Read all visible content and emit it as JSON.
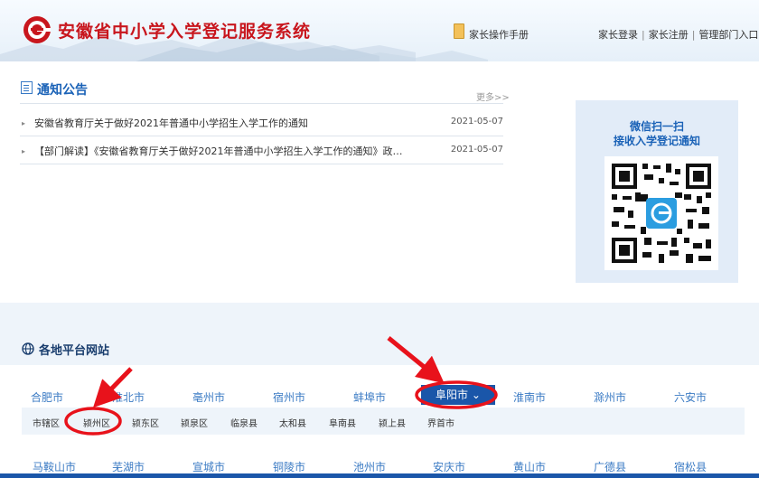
{
  "header": {
    "title": "安徽省中小学入学登记服务系统",
    "manual": "家长操作手册",
    "nav": [
      "家长登录",
      "家长注册",
      "管理部门入口"
    ]
  },
  "notice": {
    "title": "通知公告",
    "more": "更多>>",
    "items": [
      {
        "title": "安徽省教育厅关于做好2021年普通中小学招生入学工作的通知",
        "date": "2021-05-07"
      },
      {
        "title": "【部门解读】《安徽省教育厅关于做好2021年普通中小学招生入学工作的通知》政…",
        "date": "2021-05-07"
      }
    ]
  },
  "wechat": {
    "line1": "微信扫一扫",
    "line2": "接收入学登记通知"
  },
  "platforms": {
    "title": "各地平台网站",
    "row1": [
      "合肥市",
      "淮北市",
      "亳州市",
      "宿州市",
      "蚌埠市",
      "阜阳市",
      "淮南市",
      "滁州市",
      "六安市"
    ],
    "active": "阜阳市",
    "districts": [
      "市辖区",
      "颍州区",
      "颍东区",
      "颍泉区",
      "临泉县",
      "太和县",
      "阜南县",
      "颍上县",
      "界首市"
    ],
    "row2": [
      "马鞍山市",
      "芜湖市",
      "宣城市",
      "铜陵市",
      "池州市",
      "安庆市",
      "黄山市",
      "广德县",
      "宿松县"
    ]
  },
  "colors": {
    "brand_red": "#c8161d",
    "link_blue": "#3b7bc4",
    "active_blue": "#1a56a9",
    "annotation_red": "#e8121b"
  }
}
